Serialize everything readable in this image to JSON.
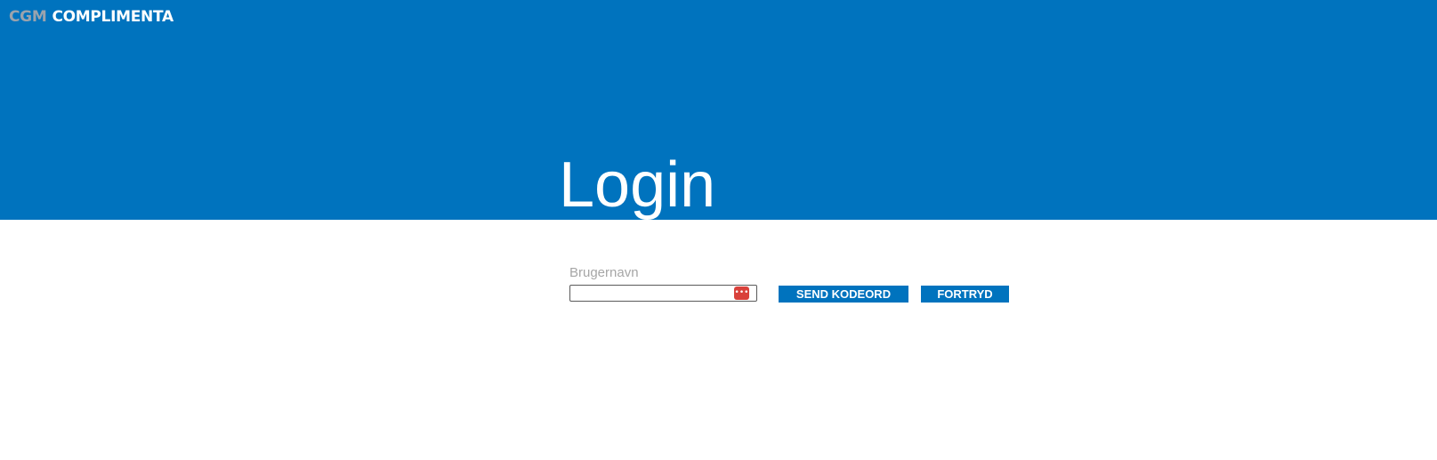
{
  "header": {
    "logo_part1": "CGM",
    "logo_part2": "COMPLIMENTA",
    "title": "Login"
  },
  "form": {
    "username_label": "Brugernavn",
    "username_value": "",
    "password_manager_icon": "dots-key-icon",
    "send_button": "SEND KODEORD",
    "cancel_button": "FORTRYD"
  },
  "colors": {
    "header_bg": "#0073be",
    "button_bg": "#0073be",
    "logo_grey": "#9aa3ad",
    "label_grey": "#a6a6a6",
    "icon_red": "#d9413b"
  }
}
